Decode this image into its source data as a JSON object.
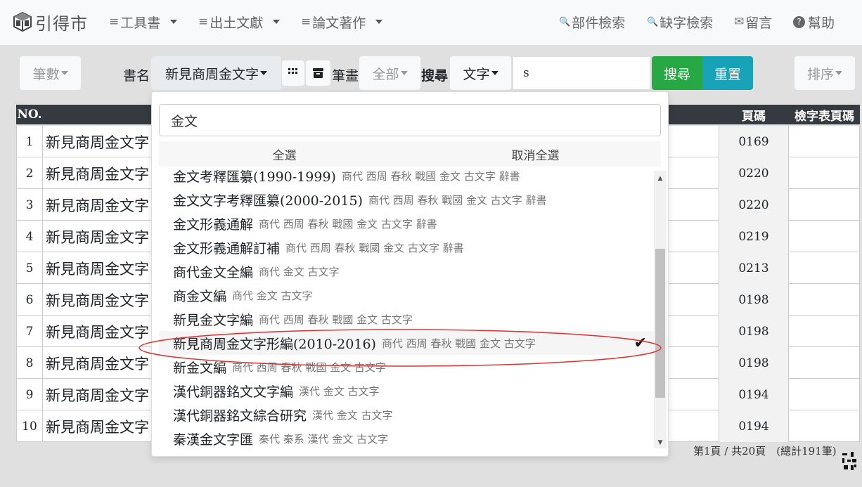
{
  "brand": {
    "name": "引得市"
  },
  "nav": {
    "items": [
      {
        "label": "工具書",
        "glyph": "≡",
        "caret": true
      },
      {
        "label": "出土文獻",
        "glyph": "≡",
        "caret": true
      },
      {
        "label": "論文著作",
        "glyph": "≡",
        "caret": true
      }
    ],
    "right": [
      {
        "label": "部件檢索",
        "glyph": "🔍"
      },
      {
        "label": "缺字檢索",
        "glyph": "🔍"
      },
      {
        "label": "留言",
        "glyph": "✉"
      },
      {
        "label": "幫助",
        "glyph": "?"
      }
    ]
  },
  "toolbar": {
    "count_label": "筆數",
    "book_label": "書名",
    "book_value": "新見商周金文字",
    "stroke_label": "筆畫",
    "stroke_value": "全部",
    "search_label": "搜尋",
    "search_type": "文字",
    "search_value": "s",
    "search_button": "搜尋",
    "reset_button": "重置",
    "sort_button": "排序"
  },
  "table": {
    "headers": {
      "no": "NO.",
      "page": "頁碼",
      "index_page": "檢字表頁碼"
    },
    "rows": [
      {
        "no": "1",
        "name": "新見商周金文字",
        "page": "0169"
      },
      {
        "no": "2",
        "name": "新見商周金文字",
        "page": "0220"
      },
      {
        "no": "3",
        "name": "新見商周金文字",
        "page": "0220"
      },
      {
        "no": "4",
        "name": "新見商周金文字",
        "page": "0219"
      },
      {
        "no": "5",
        "name": "新見商周金文字",
        "page": "0213"
      },
      {
        "no": "6",
        "name": "新見商周金文字",
        "page": "0198"
      },
      {
        "no": "7",
        "name": "新見商周金文字",
        "page": "0198"
      },
      {
        "no": "8",
        "name": "新見商周金文字",
        "page": "0198"
      },
      {
        "no": "9",
        "name": "新見商周金文字",
        "page": "0194"
      },
      {
        "no": "10",
        "name": "新見商周金文字",
        "page": "0194"
      }
    ]
  },
  "dropdown": {
    "search_value": "金文",
    "select_all": "全選",
    "deselect_all": "取消全選",
    "items": [
      {
        "name": "金文考釋匯纂(1990-1999)",
        "tags": "商代 西周 春秋 戰國 金文 古文字 辭書"
      },
      {
        "name": "金文文字考釋匯纂(2000-2015)",
        "tags": "商代 西周 春秋 戰國 金文 古文字 辭書"
      },
      {
        "name": "金文形義通解",
        "tags": "商代 西周 春秋 戰國 金文 古文字 辭書"
      },
      {
        "name": "金文形義通解訂補",
        "tags": "商代 西周 春秋 戰國 金文 古文字 辭書"
      },
      {
        "name": "商代金文全編",
        "tags": "商代 金文 古文字"
      },
      {
        "name": "商金文編",
        "tags": "商代 金文 古文字"
      },
      {
        "name": "新見金文字編",
        "tags": "商代 西周 春秋 戰國 金文 古文字"
      },
      {
        "name": "新見商周金文字形編(2010-2016)",
        "tags": "商代 西周 春秋 戰國 金文 古文字",
        "selected": true
      },
      {
        "name": "新金文編",
        "tags": "商代 西周 春秋 戰國 金文 古文字"
      },
      {
        "name": "漢代銅器銘文文字編",
        "tags": "漢代 金文 古文字"
      },
      {
        "name": "漢代銅器銘文綜合研究",
        "tags": "漢代 金文 古文字"
      },
      {
        "name": "秦漢金文字匯",
        "tags": "秦代 秦系 漢代 金文 古文字"
      }
    ]
  },
  "footer": {
    "pagination": "第1頁 / 共20頁　(總計191筆)"
  },
  "colors": {
    "search": "#28a745",
    "reset": "#17a2b8",
    "header": "#343a40",
    "annotation": "#e03030"
  }
}
